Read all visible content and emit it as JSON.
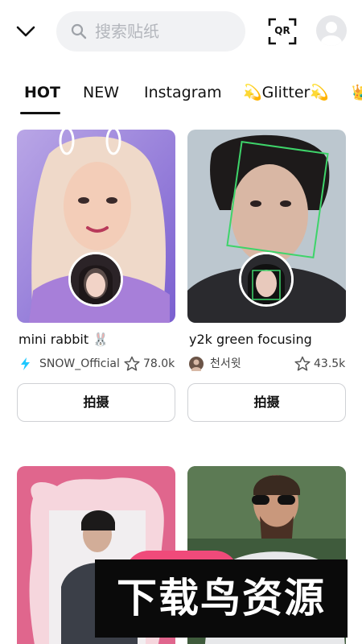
{
  "header": {
    "search_placeholder": "搜索贴纸",
    "qr_label": "QR"
  },
  "tabs": [
    {
      "label": "HOT",
      "active": true
    },
    {
      "label": "NEW",
      "active": false
    },
    {
      "label": "Instagram",
      "active": false
    },
    {
      "label": "💫Glitter💫",
      "active": false
    },
    {
      "label": "👑",
      "active": false
    }
  ],
  "stickers": [
    {
      "title": "mini rabbit 🐰",
      "author": "SNOW_Official",
      "author_icon": "snow-logo-icon",
      "likes": "78.0k",
      "action_label": "拍摄"
    },
    {
      "title": "y2k green focusing",
      "author": "천서윗",
      "author_icon": "user-avatar-icon",
      "likes": "43.5k",
      "action_label": "拍摄"
    },
    {
      "title": "",
      "author": "",
      "likes": "",
      "action_label": ""
    },
    {
      "title": "",
      "author": "",
      "likes": "",
      "action_label": ""
    }
  ],
  "watermark": "下载鸟资源",
  "colors": {
    "accent_pink": "#f04a7a",
    "snow_blue": "#1ec8ff",
    "focus_green": "#3ed46a",
    "text_primary": "#111111",
    "text_secondary": "#444444"
  }
}
